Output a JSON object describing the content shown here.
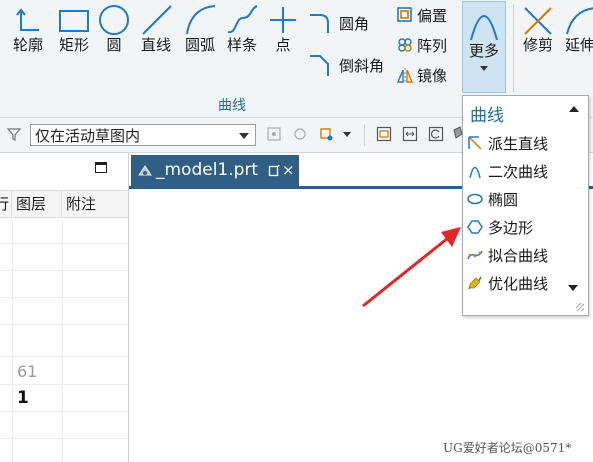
{
  "ribbon": {
    "tools": [
      {
        "id": "profile",
        "label": "轮廓",
        "icon": "profile-icon"
      },
      {
        "id": "rectangle",
        "label": "矩形",
        "icon": "rectangle-icon"
      },
      {
        "id": "circle",
        "label": "圆",
        "icon": "circle-icon"
      },
      {
        "id": "line",
        "label": "直线",
        "icon": "line-icon"
      },
      {
        "id": "arc",
        "label": "圆弧",
        "icon": "arc-icon"
      },
      {
        "id": "spline",
        "label": "样条",
        "icon": "spline-icon"
      },
      {
        "id": "point",
        "label": "点",
        "icon": "point-icon"
      }
    ],
    "small_tools_col1": [
      {
        "label": "圆角",
        "icon": "fillet-icon"
      },
      {
        "label": "倒斜角",
        "icon": "chamfer-icon"
      }
    ],
    "small_tools_col2": [
      {
        "label": "偏置",
        "icon": "offset-icon"
      },
      {
        "label": "阵列",
        "icon": "pattern-icon"
      },
      {
        "label": "镜像",
        "icon": "mirror-icon"
      }
    ],
    "more_label": "更多",
    "edit_tools": [
      {
        "label": "修剪",
        "icon": "trim-icon"
      },
      {
        "label": "延伸",
        "icon": "extend-icon"
      }
    ],
    "group_label": "曲线"
  },
  "filterbar": {
    "scope_value": "仅在活动草图内"
  },
  "left_panel": {
    "columns": [
      "行",
      "图层",
      "附注"
    ],
    "cells": [
      "61",
      "1"
    ]
  },
  "tabs": {
    "active_label": "_model1.prt"
  },
  "dropdown": {
    "title": "曲线",
    "items": [
      {
        "label": "派生直线",
        "icon": "derived-line-icon"
      },
      {
        "label": "二次曲线",
        "icon": "conic-icon"
      },
      {
        "label": "椭圆",
        "icon": "ellipse-icon"
      },
      {
        "label": "多边形",
        "icon": "polygon-icon"
      },
      {
        "label": "拟合曲线",
        "icon": "fit-curve-icon"
      },
      {
        "label": "优化曲线",
        "icon": "optimize-curve-icon"
      }
    ]
  },
  "watermark": "UG爱好者论坛@0571*",
  "colors": {
    "accent": "#2f5f84",
    "ribbon_label": "#1f6e9d",
    "arrow": "#e02626",
    "icon": "#1e7bc4"
  }
}
